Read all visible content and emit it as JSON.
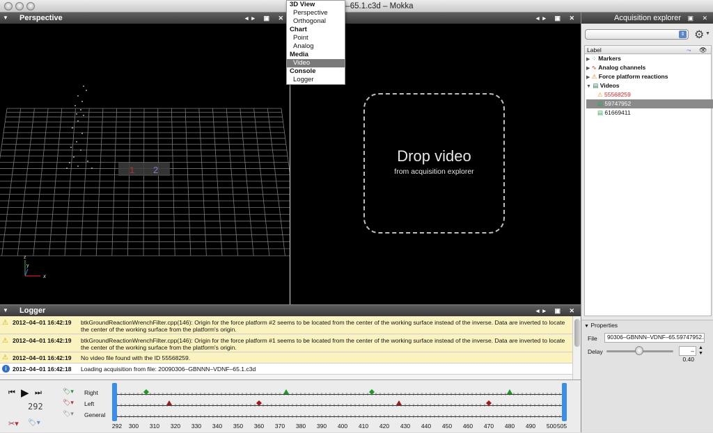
{
  "window": {
    "title": "…NN–VDNF–65.1.c3d – Mokka"
  },
  "perspective": {
    "title": "Perspective",
    "axis_x": "x",
    "axis_y": "y",
    "axis_z": "z",
    "platform_labels": [
      "1",
      "2"
    ]
  },
  "menu": {
    "groups": [
      {
        "heading": "3D View",
        "items": [
          "Perspective",
          "Orthogonal"
        ]
      },
      {
        "heading": "Chart",
        "items": [
          "Point",
          "Analog"
        ]
      },
      {
        "heading": "Media",
        "items": [
          "Video"
        ]
      },
      {
        "heading": "Console",
        "items": [
          "Logger"
        ]
      }
    ],
    "selected": "Video"
  },
  "video": {
    "title": "Drop video",
    "subtitle": "from acquisition explorer"
  },
  "explorer": {
    "title": "Acquisition explorer",
    "column_label": "Label",
    "items": [
      {
        "label": "Markers",
        "icon": "markers-icon",
        "bold": true
      },
      {
        "label": "Analog channels",
        "icon": "analog-icon",
        "bold": true
      },
      {
        "label": "Force platform reactions",
        "icon": "force-icon",
        "bold": true
      },
      {
        "label": "Videos",
        "icon": "video-icon",
        "bold": true
      },
      {
        "label": "55568259",
        "icon": "video-warning-icon",
        "child": true,
        "color": "#e02020"
      },
      {
        "label": "59747952",
        "icon": "film-icon",
        "child": true,
        "selected": true
      },
      {
        "label": "61669411",
        "icon": "film-icon",
        "child": true
      }
    ],
    "properties": {
      "title": "Properties",
      "file_label": "File",
      "file_value": "90306–GBNNN–VDNF–65.59747952.avi",
      "delay_label": "Delay",
      "delay_value": "–0.40"
    }
  },
  "logger": {
    "title": "Logger",
    "rows": [
      {
        "type": "warning",
        "time": "2012–04–01 16:42:19",
        "message": "btkGroundReactionWrenchFilter.cpp(146): Origin for the force platform #2 seems to be located from the center of the working surface instead of the inverse. Data are inverted to locate the center of the working surface from the platform's origin."
      },
      {
        "type": "warning",
        "time": "2012–04–01 16:42:19",
        "message": "btkGroundReactionWrenchFilter.cpp(146): Origin for the force platform #1 seems to be located from the center of the working surface instead of the inverse. Data are inverted to locate the center of the working surface from the platform's origin."
      },
      {
        "type": "warning",
        "time": "2012–04–01 16:42:19",
        "message": "No video file found with the ID 55568259."
      },
      {
        "type": "info",
        "time": "2012–04–01 16:42:18",
        "message": "Loading acquisition from file: 20090306–GBNNN–VDNF–65.1.c3d"
      }
    ]
  },
  "timeline": {
    "current_frame": "292",
    "tracks": [
      "Right",
      "Left",
      "General"
    ],
    "ticks": [
      "292",
      "300",
      "310",
      "320",
      "330",
      "340",
      "350",
      "360",
      "370",
      "380",
      "390",
      "400",
      "410",
      "420",
      "430",
      "440",
      "450",
      "460",
      "470",
      "480",
      "490",
      "500",
      "505"
    ],
    "range": [
      292,
      505
    ],
    "events": [
      {
        "track": "Right",
        "frame": 306,
        "kind": "diamond"
      },
      {
        "track": "Right",
        "frame": 373,
        "kind": "triangle"
      },
      {
        "track": "Right",
        "frame": 414,
        "kind": "diamond"
      },
      {
        "track": "Right",
        "frame": 480,
        "kind": "triangle"
      },
      {
        "track": "Left",
        "frame": 317,
        "kind": "triangle"
      },
      {
        "track": "Left",
        "frame": 360,
        "kind": "diamond"
      },
      {
        "track": "Left",
        "frame": 427,
        "kind": "triangle"
      },
      {
        "track": "Left",
        "frame": 470,
        "kind": "diamond"
      }
    ],
    "colors": {
      "right": "#1f9a2a",
      "left": "#a01c1c",
      "marker": "#3b8ee8"
    }
  }
}
